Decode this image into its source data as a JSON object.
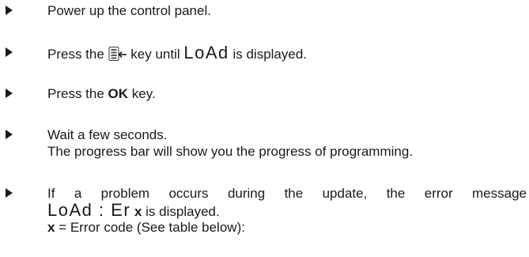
{
  "steps": [
    {
      "text": "Power up the control panel."
    },
    {
      "before": "Press the ",
      "icon": "menu-key-icon",
      "middle": " key until ",
      "display": "LoAd",
      "after": " is displayed."
    },
    {
      "before": "Press the ",
      "key": "OK",
      "after": " key."
    },
    {
      "line1": "Wait a few seconds.",
      "line2": "The progress bar will show you the progress of programming."
    },
    {
      "line1": "If a problem occurs during the update, the error message",
      "display": "LoAd : Er",
      "code_var": "x",
      "after": " is displayed.",
      "legend_var": "x",
      "legend_text": " = Error code (See table below):"
    }
  ]
}
